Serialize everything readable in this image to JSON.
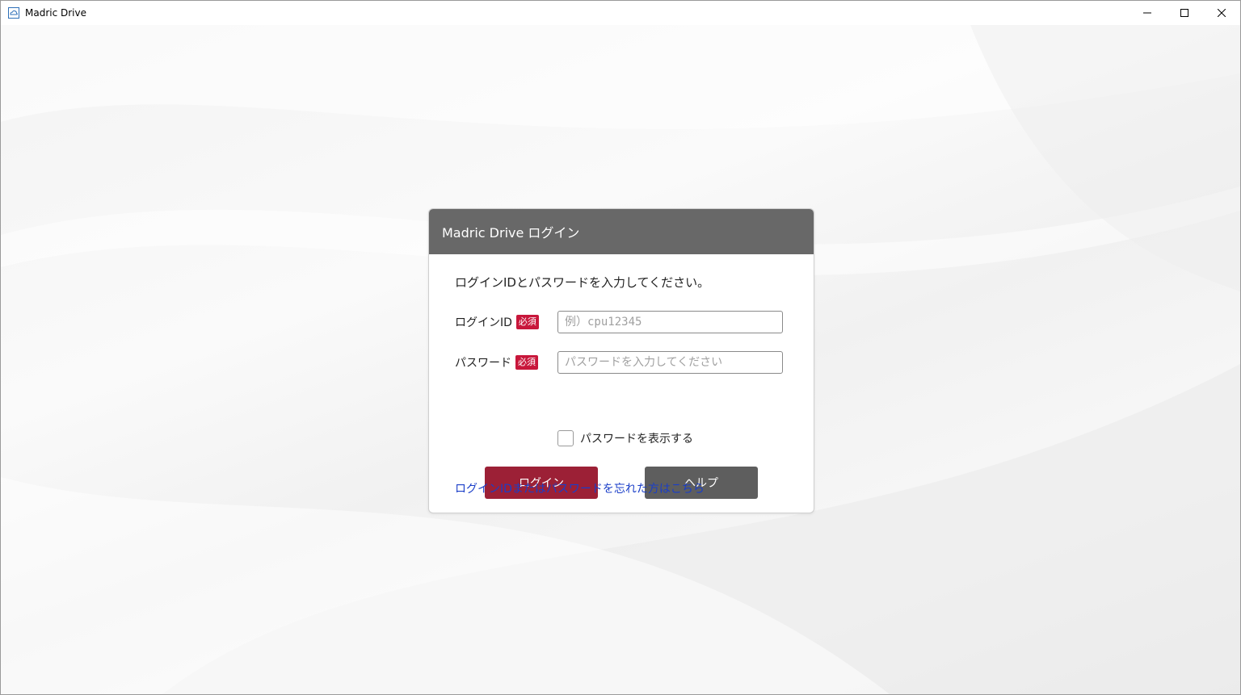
{
  "window": {
    "title": "Madric Drive",
    "icon": "madric-drive-app-icon",
    "controls": [
      "minimize-icon",
      "maximize-icon",
      "close-icon"
    ]
  },
  "dialog": {
    "header": "Madric Drive  ログイン",
    "instruction": "ログインIDとパスワードを入力してください。",
    "fields": {
      "login_id": {
        "label": "ログインID",
        "required_badge": "必須",
        "value": "",
        "placeholder": "例）cpu12345"
      },
      "password": {
        "label": "パスワード",
        "required_badge": "必須",
        "value": "",
        "placeholder": "パスワードを入力してください"
      }
    },
    "show_password": {
      "label": "パスワードを表示する",
      "checked": false
    },
    "buttons": {
      "login": "ログイン",
      "help": "ヘルプ"
    },
    "forgot_link": "ログインIDまたはパスワードを忘れた方はこちら"
  },
  "colors": {
    "header_bg": "#686868",
    "required_badge": "#c8173b",
    "login_button": "#9c2036",
    "help_button": "#5e5e5e",
    "link": "#1a3ec8"
  }
}
